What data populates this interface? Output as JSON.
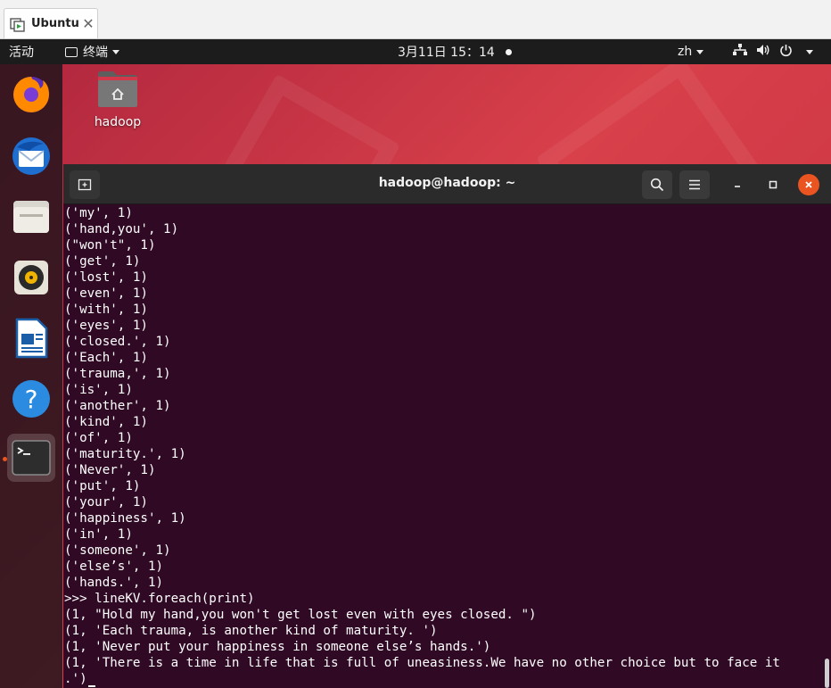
{
  "vm_tab": {
    "label": "Ubuntu",
    "close": "✕"
  },
  "topbar": {
    "activities": "活动",
    "app_menu": "终端",
    "clock": "3月11日  15：14",
    "lang": "zh"
  },
  "desktop": {
    "home_label": "hadoop"
  },
  "dock": {
    "items": [
      {
        "name": "firefox-icon"
      },
      {
        "name": "thunderbird-icon"
      },
      {
        "name": "files-icon"
      },
      {
        "name": "rhythmbox-icon"
      },
      {
        "name": "libreoffice-writer-icon"
      },
      {
        "name": "help-icon"
      },
      {
        "name": "terminal-icon"
      }
    ]
  },
  "terminal": {
    "title": "hadoop@hadoop: ~",
    "lines": [
      "('my', 1)",
      "('hand,you', 1)",
      "(\"won't\", 1)",
      "('get', 1)",
      "('lost', 1)",
      "('even', 1)",
      "('with', 1)",
      "('eyes', 1)",
      "('closed.', 1)",
      "('Each', 1)",
      "('trauma,', 1)",
      "('is', 1)",
      "('another', 1)",
      "('kind', 1)",
      "('of', 1)",
      "('maturity.', 1)",
      "('Never', 1)",
      "('put', 1)",
      "('your', 1)",
      "('happiness', 1)",
      "('in', 1)",
      "('someone', 1)",
      "('else’s', 1)",
      "('hands.', 1)",
      ">>> lineKV.foreach(print)",
      "(1, \"Hold my hand,you won't get lost even with eyes closed. \")",
      "(1, 'Each trauma, is another kind of maturity. ')",
      "(1, 'Never put your happiness in someone else’s hands.')",
      "(1, 'There is a time in life that is full of uneasiness.We have no other choice but to face it",
      ".')"
    ]
  },
  "colors": {
    "terminal_bg": "#300a24",
    "header_bg": "#2b2b2b",
    "close_button": "#e95420",
    "dock_bg": "#281419"
  }
}
